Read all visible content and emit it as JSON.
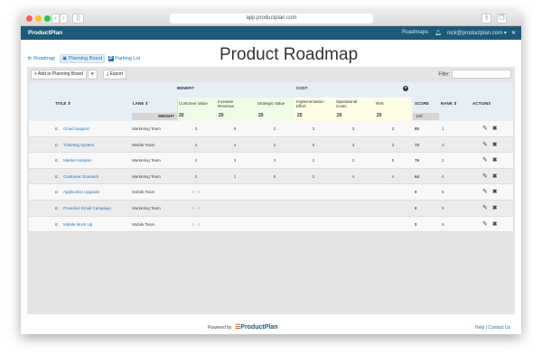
{
  "browser": {
    "url": "app.productplan.com"
  },
  "nav": {
    "brand": "ProductPlan",
    "roadmaps": "Roadmaps",
    "user": "nick@productplan.com ▾"
  },
  "views": {
    "roadmap": "Roadmap",
    "planning": "Planning Board",
    "parking": "Parking Lot"
  },
  "title": "Product Roadmap",
  "toolbar": {
    "add": "+ Add to Planning Board",
    "caret": "▾",
    "export": "⤓ Export",
    "filter_label": "Filter:",
    "filter_value": ""
  },
  "headers": {
    "benefit": "BENEFIT",
    "cost": "COST",
    "title": "TITLE ⇕",
    "lane": "LANE ⇕",
    "weight": "WEIGHT",
    "score": "SCORE",
    "rank": "RANK ⇕",
    "actions": "ACTIONS",
    "help": "?",
    "criteria": [
      {
        "label": "Customer Value",
        "weight": "20"
      },
      {
        "label": "Increase Revenue",
        "weight": "20"
      },
      {
        "label": "Strategic Value",
        "weight": "20"
      },
      {
        "label": "Implementation Effort",
        "weight": "20"
      },
      {
        "label": "Operational Costs",
        "weight": "20"
      },
      {
        "label": "Risk",
        "weight": "20"
      }
    ],
    "total_weight": "120"
  },
  "rows": [
    {
      "title": "Cloud Support",
      "lane": "Marketing Team",
      "scores": [
        "3",
        "5",
        "2",
        "3",
        "3",
        "2"
      ],
      "score": "80",
      "rank": "1"
    },
    {
      "title": "Ticketing System",
      "lane": "Mobile Team",
      "scores": [
        "4",
        "4",
        "3",
        "5",
        "3",
        "3"
      ],
      "score": "72",
      "rank": "3"
    },
    {
      "title": "Market Analysis",
      "lane": "Marketing Team",
      "scores": [
        "4",
        "3",
        "3",
        "2",
        "2",
        "5"
      ],
      "score": "76",
      "rank": "2"
    },
    {
      "title": "Customer Outreach",
      "lane": "Marketing Team",
      "scores": [
        "2",
        "1",
        "5",
        "2",
        "4",
        "4"
      ],
      "score": "64",
      "rank": "4"
    },
    {
      "title": "Application Upgrade",
      "lane": "Mobile Team",
      "scores": [
        "0 - 5",
        "",
        "",
        "",
        "",
        ""
      ],
      "score": "0",
      "rank": "5"
    },
    {
      "title": "Proactive Email Campaign",
      "lane": "Marketing Team",
      "scores": [
        "0 - 5",
        "",
        "",
        "",
        "",
        ""
      ],
      "score": "0",
      "rank": "5"
    },
    {
      "title": "Mobile Mock Up",
      "lane": "Mobile Team",
      "scores": [
        "0 - 5",
        "",
        "",
        "",
        "",
        ""
      ],
      "score": "0",
      "rank": "5"
    }
  ],
  "footer": {
    "powered": "Powered by",
    "logo": "ProductPlan",
    "help": "Help | Contact Us"
  }
}
